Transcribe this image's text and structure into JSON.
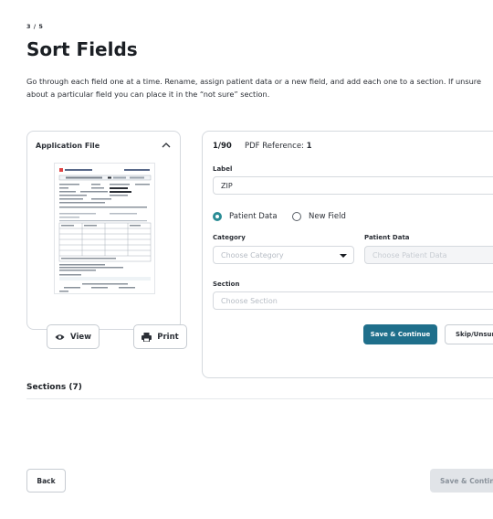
{
  "header": {
    "step": "3 / 5",
    "title": "Sort Fields",
    "description": "Go through each field one at a time. Rename, assign patient data or a new field, and add each one to a section. If unsure about a particular field you can place it in the “not sure” section."
  },
  "application_file": {
    "title": "Application File",
    "view_label": "View",
    "print_label": "Print"
  },
  "field_form": {
    "counter": "1/90",
    "pdf_reference_label": "PDF Reference:",
    "pdf_reference_value": "1",
    "label_title": "Label",
    "label_value": "ZIP",
    "radio_patient_data": "Patient Data",
    "radio_new_field": "New Field",
    "selected_option": "Patient Data",
    "category_title": "Category",
    "category_placeholder": "Choose Category",
    "patient_data_title": "Patient Data",
    "patient_data_placeholder": "Choose Patient Data",
    "section_title": "Section",
    "section_placeholder": "Choose Section",
    "save_continue": "Save & Continue",
    "skip_unsure": "Skip/Unsure"
  },
  "sections": {
    "title": "Sections (7)"
  },
  "footer": {
    "back": "Back",
    "save_continue": "Save & Continue"
  },
  "colors": {
    "primary": "#1f6f8b",
    "radio_accent": "#2a8c95",
    "disabled_bg": "#e1e4e8"
  }
}
